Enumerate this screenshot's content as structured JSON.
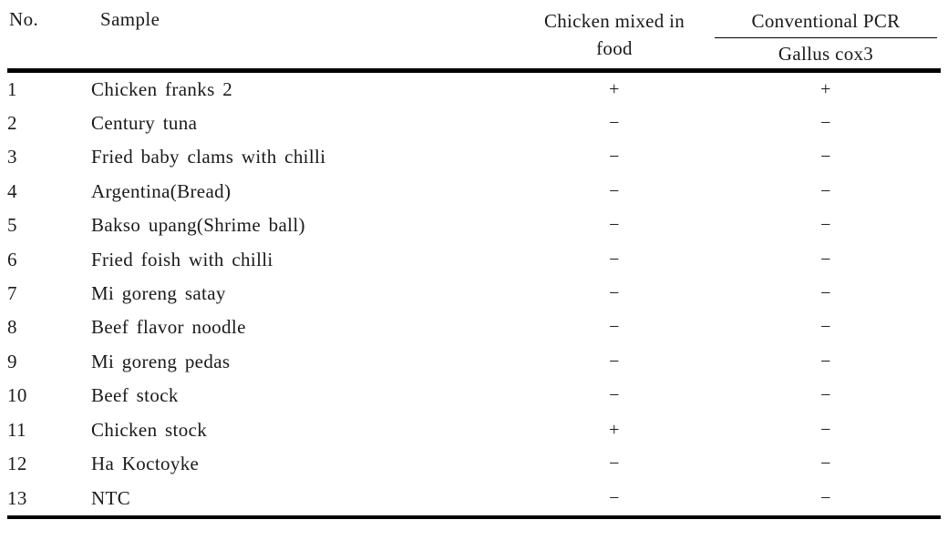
{
  "table": {
    "headers": {
      "no": "No.",
      "sample": "Sample",
      "mixed_line1": "Chicken mixed in",
      "mixed_line2": "food",
      "pcr_group": "Conventional PCR",
      "pcr_target": "Gallus cox3"
    },
    "rows": [
      {
        "no": "1",
        "sample": "Chicken franks 2",
        "mixed": "+",
        "pcr": "+"
      },
      {
        "no": "2",
        "sample": "Century tuna",
        "mixed": "−",
        "pcr": "−"
      },
      {
        "no": "3",
        "sample": "Fried baby clams with chilli",
        "mixed": "−",
        "pcr": "−"
      },
      {
        "no": "4",
        "sample": "Argentina(Bread)",
        "mixed": "−",
        "pcr": "−"
      },
      {
        "no": "5",
        "sample": "Bakso upang(Shrime ball)",
        "mixed": "−",
        "pcr": "−"
      },
      {
        "no": "6",
        "sample": "Fried foish with chilli",
        "mixed": "−",
        "pcr": "−"
      },
      {
        "no": "7",
        "sample": "Mi goreng satay",
        "mixed": "−",
        "pcr": "−"
      },
      {
        "no": "8",
        "sample": "Beef flavor noodle",
        "mixed": "−",
        "pcr": "−"
      },
      {
        "no": "9",
        "sample": "Mi goreng pedas",
        "mixed": "−",
        "pcr": "−"
      },
      {
        "no": "10",
        "sample": "Beef stock",
        "mixed": "−",
        "pcr": "−"
      },
      {
        "no": "11",
        "sample": "Chicken stock",
        "mixed": "+",
        "pcr": "−"
      },
      {
        "no": "12",
        "sample": "Ha Koctoyke",
        "mixed": "−",
        "pcr": "−"
      },
      {
        "no": "13",
        "sample": "NTC",
        "mixed": "−",
        "pcr": "−"
      }
    ]
  },
  "colors": {
    "rule": "#000000",
    "text": "#1a1a1a",
    "background": "#ffffff"
  }
}
